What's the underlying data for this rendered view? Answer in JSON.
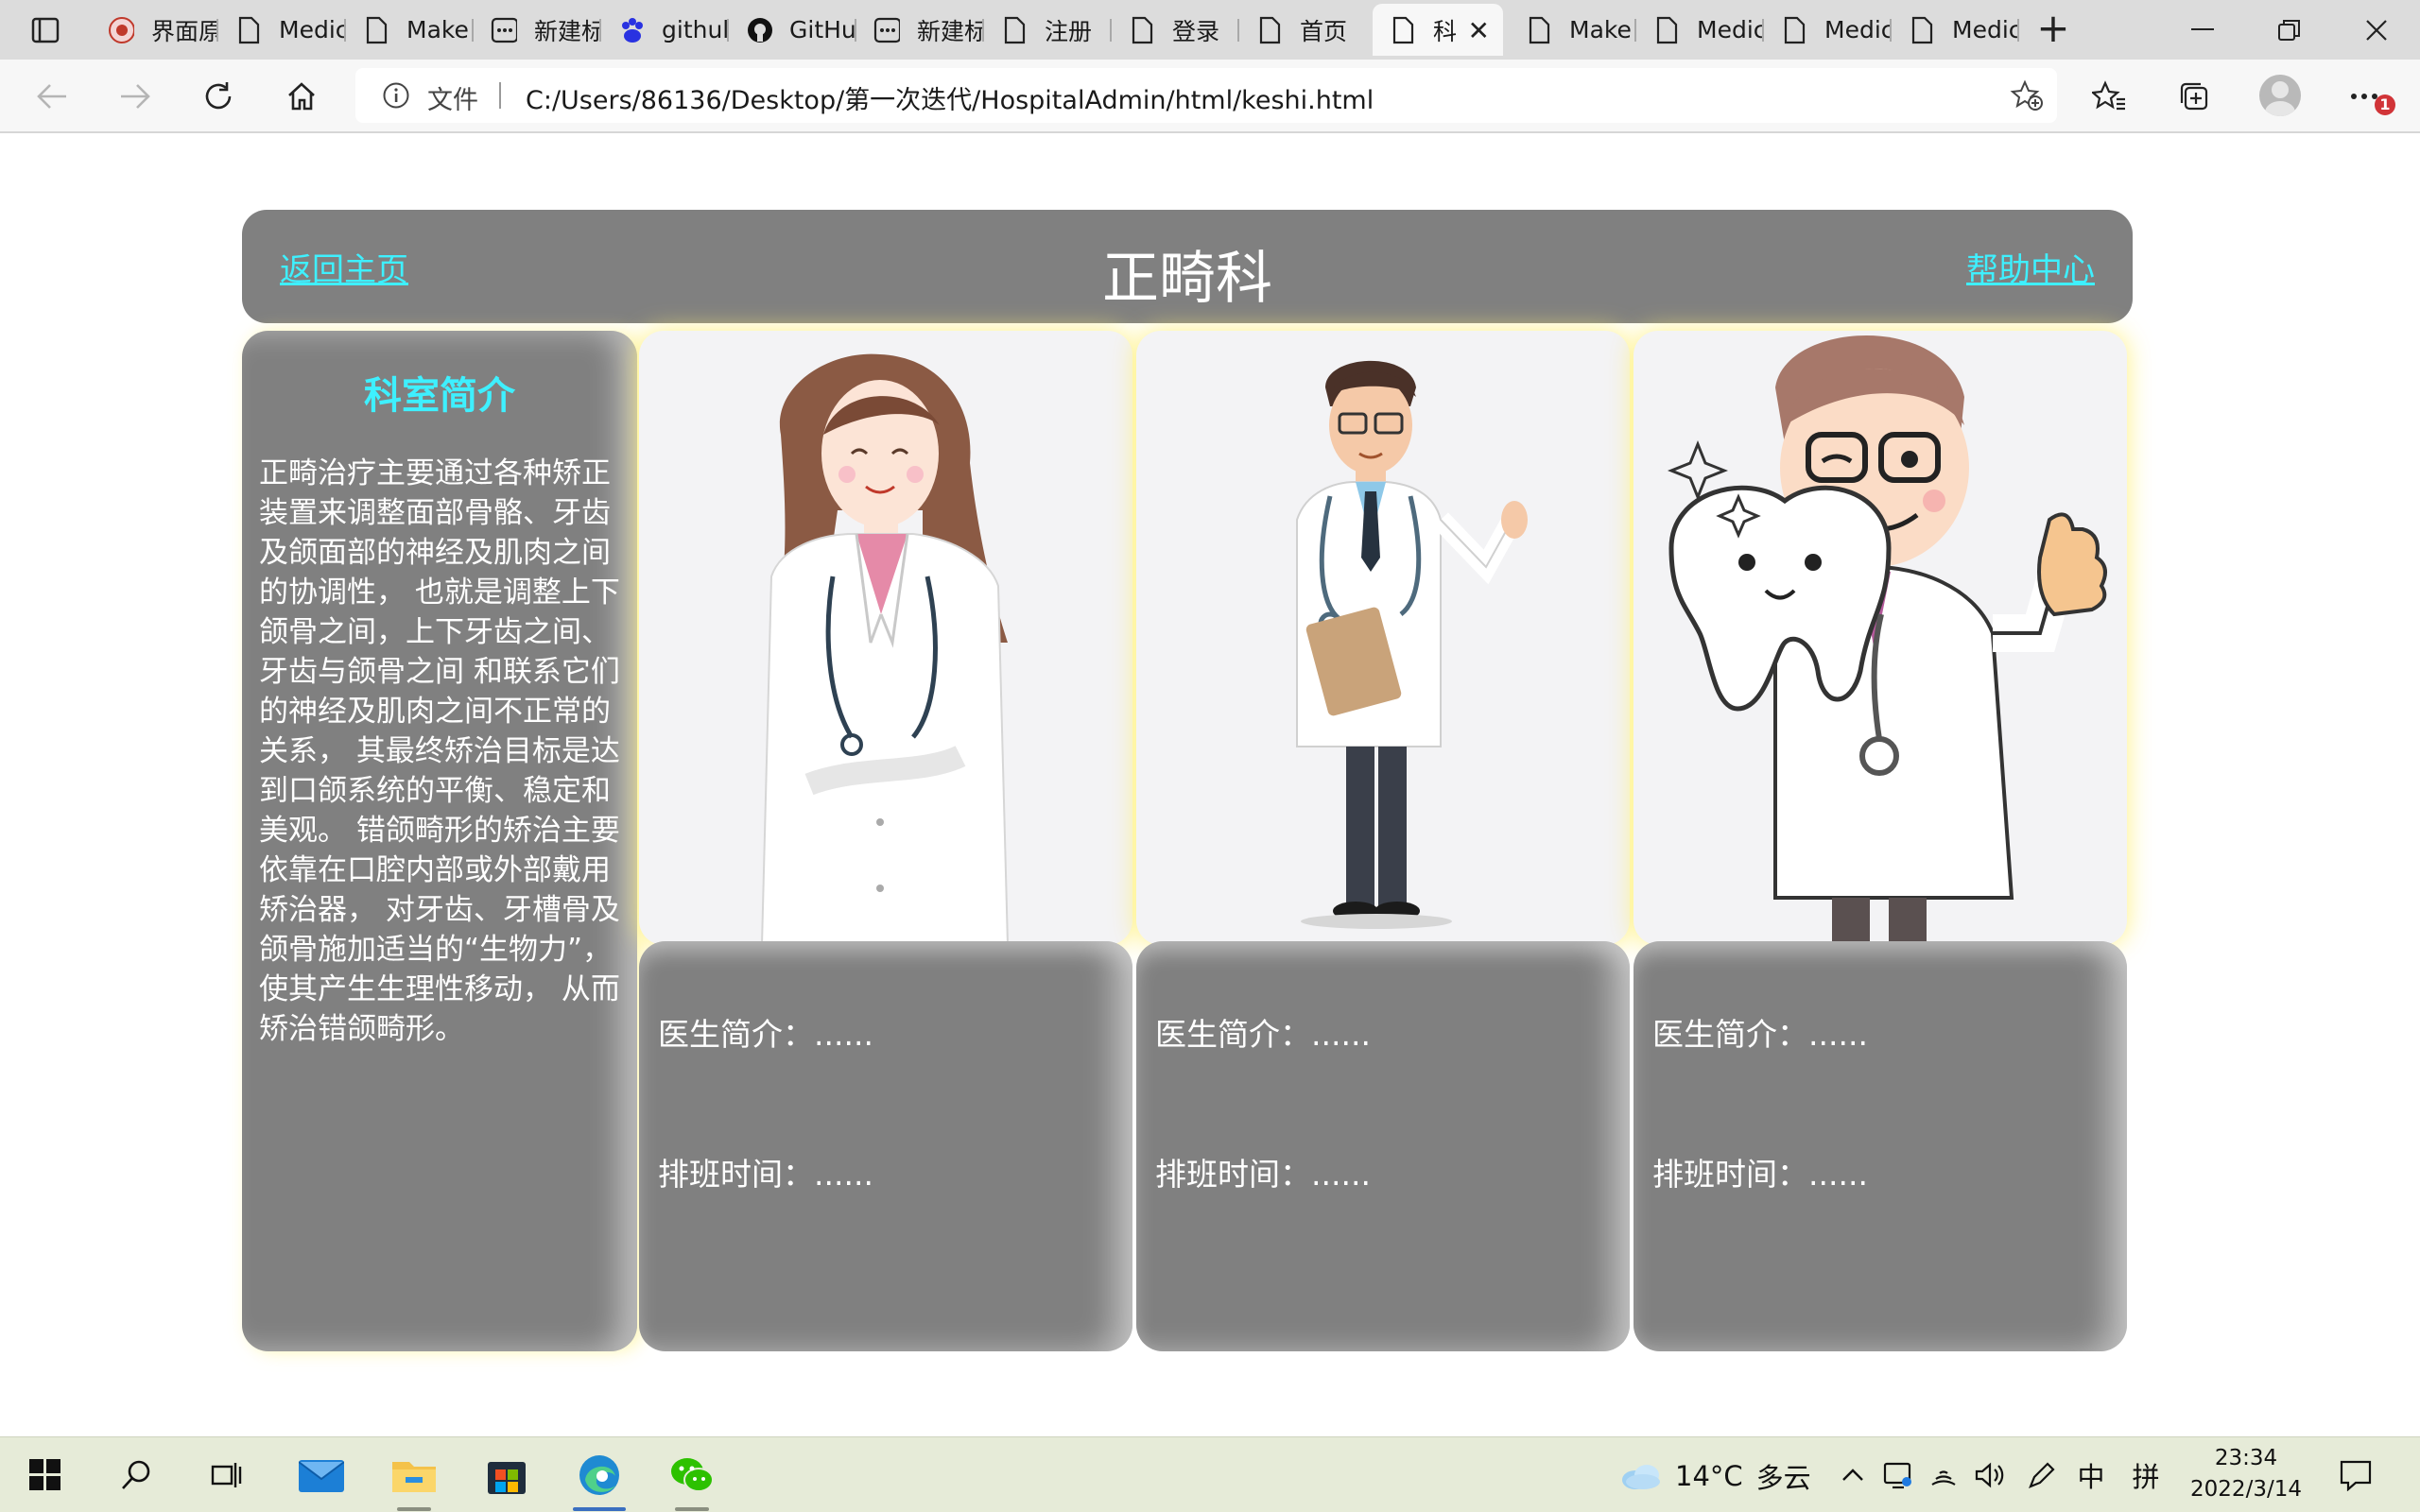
{
  "browser": {
    "tabs": [
      {
        "label": "界面原",
        "icon": "university-logo-icon"
      },
      {
        "label": "Medic",
        "icon": "document-icon"
      },
      {
        "label": "Make",
        "icon": "document-icon"
      },
      {
        "label": "新建标",
        "icon": "window-icon"
      },
      {
        "label": "githul",
        "icon": "baidu-paw-icon"
      },
      {
        "label": "GitHu",
        "icon": "github-icon"
      },
      {
        "label": "新建标",
        "icon": "window-icon"
      },
      {
        "label": "注册",
        "icon": "document-icon"
      },
      {
        "label": "登录",
        "icon": "document-icon"
      },
      {
        "label": "首页",
        "icon": "document-icon"
      },
      {
        "label": "科",
        "icon": "document-icon",
        "active": true
      },
      {
        "label": "Make",
        "icon": "document-icon"
      },
      {
        "label": "Medic",
        "icon": "document-icon"
      },
      {
        "label": "Medic",
        "icon": "document-icon"
      },
      {
        "label": "Medic",
        "icon": "document-icon"
      }
    ],
    "address": {
      "scheme_label": "文件",
      "url": "C:/Users/86136/Desktop/第一次迭代/HospitalAdmin/html/keshi.html"
    },
    "notification_badge": "1"
  },
  "page": {
    "header": {
      "home_link": "返回主页",
      "title": "正畸科",
      "help_link": "帮助中心"
    },
    "intro": {
      "heading": "科室简介",
      "text": "正畸治疗主要通过各种矫正装置来调整面部骨骼、牙齿及颌面部的神经及肌肉之间的协调性， 也就是调整上下颌骨之间，上下牙齿之间、牙齿与颌骨之间 和联系它们的神经及肌肉之间不正常的关系， 其最终矫治目标是达到口颌系统的平衡、稳定和美观。 错颌畸形的矫治主要依靠在口腔内部或外部戴用矫治器， 对牙齿、牙槽骨及颌骨施加适当的“生物力”，使其产生生理性移动， 从而矫治错颌畸形。"
    },
    "doctors": [
      {
        "image": "female-doctor-illustration",
        "intro": "医生简介：......",
        "schedule": "排班时间：......"
      },
      {
        "image": "male-doctor-illustration",
        "intro": "医生简介：......",
        "schedule": "排班时间：......"
      },
      {
        "image": "dentist-with-tooth-illustration",
        "intro": "医生简介：......",
        "schedule": "排班时间：......"
      }
    ]
  },
  "taskbar": {
    "weather": {
      "temp": "14°C",
      "condition": "多云"
    },
    "ime_lang": "中",
    "ime_mode": "拼",
    "time": "23:34",
    "date": "2022/3/14"
  },
  "colors": {
    "card_gray": "#808080",
    "link_cyan": "#3ef0ff",
    "glow_yellow": "#fff06e"
  }
}
